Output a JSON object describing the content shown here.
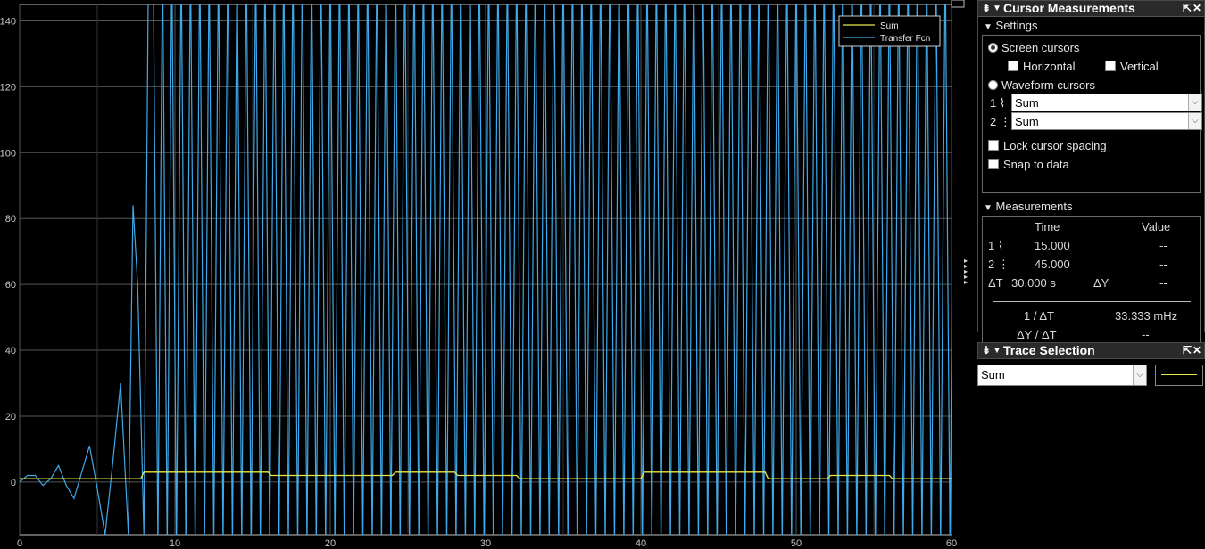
{
  "chart_data": {
    "type": "line",
    "xlim": [
      0,
      60
    ],
    "ylim": [
      -16,
      145
    ],
    "x_ticks": [
      0,
      10,
      20,
      30,
      40,
      50,
      60
    ],
    "y_ticks": [
      0,
      20,
      40,
      60,
      80,
      100,
      120,
      140
    ],
    "grid": true,
    "legend_position": "top-right",
    "background": "#000000",
    "series": [
      {
        "name": "Sum",
        "color": "#e8e84a",
        "x": [
          0,
          7.8,
          8,
          16,
          16.2,
          24,
          24.2,
          28,
          28.2,
          32,
          32.2,
          40,
          40.2,
          48,
          48.2,
          52,
          52.2,
          56,
          56.2,
          60
        ],
        "y": [
          1,
          1,
          3,
          3,
          2,
          2,
          3,
          3,
          2,
          2,
          1,
          1,
          3,
          3,
          1,
          1,
          2,
          2,
          1,
          1
        ]
      },
      {
        "name": "Transfer Fcn",
        "color": "#3fa8e8",
        "x": [
          0,
          0.5,
          1,
          1.5,
          2,
          2.5,
          3,
          3.5,
          4,
          4.5,
          5,
          5.5,
          6,
          6.5,
          7,
          7.3,
          7.6,
          8,
          8.3,
          8.6
        ],
        "y": [
          0,
          2,
          2,
          -1,
          1,
          5,
          -1,
          -5,
          3,
          11,
          -2,
          -16,
          6,
          30,
          -16,
          84,
          60,
          -16,
          160,
          160
        ],
        "oscillation": "full-height spikes continue at ~0.6 s spacing from 8.6 s to 60 s"
      }
    ]
  },
  "cursor_panel": {
    "title": "Cursor Measurements",
    "settings": {
      "header": "Settings",
      "screen_cursors": "Screen cursors",
      "horizontal": "Horizontal",
      "vertical": "Vertical",
      "waveform_cursors": "Waveform cursors",
      "cursor1_label": "1",
      "cursor2_label": "2",
      "cursor1_value": "Sum",
      "cursor2_value": "Sum",
      "lock_spacing": "Lock cursor spacing",
      "snap": "Snap to data"
    },
    "measurements": {
      "header": "Measurements",
      "col_time": "Time",
      "col_value": "Value",
      "r1_label": "1",
      "r1_time": "15.000",
      "r1_value": "--",
      "r2_label": "2",
      "r2_time": "45.000",
      "r2_value": "--",
      "dt_label": "ΔT",
      "dt_value": "30.000 s",
      "dy_label": "ΔY",
      "dy_value": "--",
      "inv_dt_label": "1 / ΔT",
      "inv_dt_value": "33.333 mHz",
      "dydt_label": "ΔY / ΔT",
      "dydt_value": "--"
    }
  },
  "trace_panel": {
    "title": "Trace Selection",
    "selected": "Sum",
    "line_color": "#e8e84a"
  }
}
